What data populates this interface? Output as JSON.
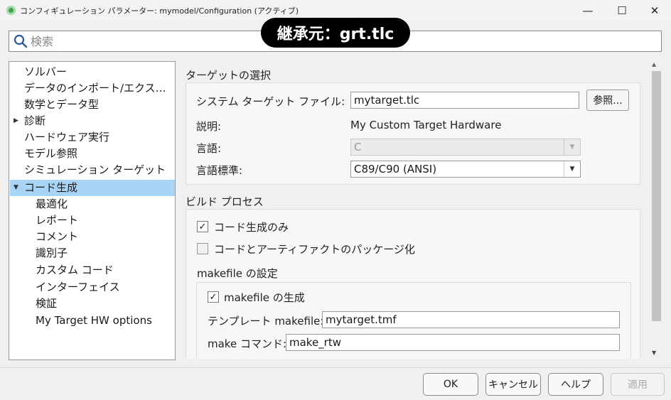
{
  "window": {
    "title": "コンフィギュレーション パラメーター: mymodel/Configuration (アクティブ)",
    "minimize": "—",
    "maximize": "☐",
    "close": "✕"
  },
  "badge": {
    "text": "継承元：grt.tlc"
  },
  "search": {
    "placeholder": "検索"
  },
  "tree": {
    "items": [
      {
        "label": "ソルバー"
      },
      {
        "label": "データのインポート/エクスポート"
      },
      {
        "label": "数学とデータ型"
      },
      {
        "label": "診断",
        "arrow": "▶"
      },
      {
        "label": "ハードウェア実行"
      },
      {
        "label": "モデル参照"
      },
      {
        "label": "シミュレーション ターゲット"
      },
      {
        "label": "コード生成",
        "arrow": "▼"
      },
      {
        "label": "最適化"
      },
      {
        "label": "レポート"
      },
      {
        "label": "コメント"
      },
      {
        "label": "識別子"
      },
      {
        "label": "カスタム コード"
      },
      {
        "label": "インターフェイス"
      },
      {
        "label": "検証"
      },
      {
        "label": "My Target HW options"
      }
    ]
  },
  "target_selection": {
    "title": "ターゲットの選択",
    "system_target_label": "システム ターゲット ファイル:",
    "system_target_value": "mytarget.tlc",
    "browse_label": "参照...",
    "description_label": "説明:",
    "description_value": "My Custom Target Hardware",
    "language_label": "言語:",
    "language_value": "C",
    "language_standard_label": "言語標準:",
    "language_standard_value": "C89/C90 (ANSI)"
  },
  "build_process": {
    "title": "ビルド プロセス",
    "generate_code_only_label": "コード生成のみ",
    "generate_code_only_checked": true,
    "package_label": "コードとアーティファクトのパッケージ化",
    "package_checked": false,
    "makefile_title": "makefile の設定",
    "generate_makefile_label": "makefile の生成",
    "generate_makefile_checked": true,
    "template_makefile_label": "テンプレート makefile:",
    "template_makefile_value": "mytarget.tmf",
    "make_command_label": "make コマンド:",
    "make_command_value": "make_rtw"
  },
  "buttons": {
    "ok": "OK",
    "cancel": "キャンセル",
    "help": "ヘルプ",
    "apply": "適用"
  },
  "colors": {
    "selected_row": "#a8d4f6",
    "badge_bg": "#000000"
  }
}
